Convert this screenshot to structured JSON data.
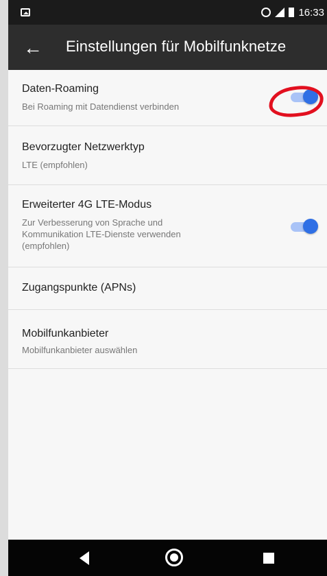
{
  "statusbar": {
    "time": "16:33",
    "left_icon": "image-notification-icon",
    "right_icons": [
      "data-saver-icon",
      "signal-icon",
      "battery-icon"
    ]
  },
  "appbar": {
    "back_icon": "arrow-back-icon",
    "title": "Einstellungen für Mobilfunknetze"
  },
  "settings": [
    {
      "title": "Daten-Roaming",
      "subtitle": "Bei Roaming mit Datendienst verbinden",
      "toggle": true,
      "toggle_on": true,
      "highlighted": true
    },
    {
      "title": "Bevorzugter Netzwerktyp",
      "subtitle": "LTE (empfohlen)",
      "toggle": false
    },
    {
      "title": "Erweiterter 4G LTE-Modus",
      "subtitle_lines": [
        "Zur Verbesserung von Sprache und",
        "Kommunikation LTE-Dienste verwenden",
        "(empfohlen)"
      ],
      "toggle": true,
      "toggle_on": true
    },
    {
      "title": "Zugangspunkte (APNs)",
      "toggle": false
    },
    {
      "title": "Mobilfunkanbieter",
      "subtitle": "Mobilfunkanbieter auswählen",
      "toggle": false
    }
  ],
  "navbar": {
    "back_icon": "nav-back-icon",
    "home_icon": "nav-home-icon",
    "recents_icon": "nav-recents-icon"
  },
  "colors": {
    "statusbar_bg": "#1b1b1b",
    "appbar_bg": "#2d2d2d",
    "content_bg": "#f7f7f7",
    "toggle_thumb": "#2f6fe5",
    "toggle_track": "#a9c3f7",
    "annotation_red": "#e2101f",
    "navbar_bg": "#050505"
  }
}
